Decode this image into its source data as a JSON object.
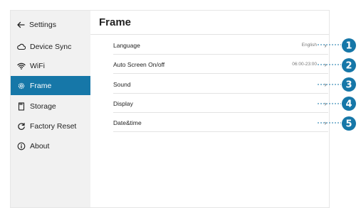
{
  "sidebar": {
    "back_label": "Settings",
    "items": [
      {
        "label": "Device Sync",
        "icon": "cloud-icon",
        "active": false
      },
      {
        "label": "WiFi",
        "icon": "wifi-icon",
        "active": false
      },
      {
        "label": "Frame",
        "icon": "gear-icon",
        "active": true
      },
      {
        "label": "Storage",
        "icon": "storage-icon",
        "active": false
      },
      {
        "label": "Factory Reset",
        "icon": "reset-icon",
        "active": false
      },
      {
        "label": "About",
        "icon": "info-icon",
        "active": false
      }
    ]
  },
  "main": {
    "title": "Frame",
    "rows": [
      {
        "label": "Language",
        "value": "English",
        "callout": "1"
      },
      {
        "label": "Auto Screen On/off",
        "value": "06:00-23:00",
        "callout": "2"
      },
      {
        "label": "Sound",
        "value": "",
        "callout": "3"
      },
      {
        "label": "Display",
        "value": "",
        "callout": "4"
      },
      {
        "label": "Date&time",
        "value": "",
        "callout": "5"
      }
    ]
  },
  "colors": {
    "accent": "#1677a8",
    "callout": "#1677a8",
    "sidebar_bg": "#f1f1f1"
  }
}
